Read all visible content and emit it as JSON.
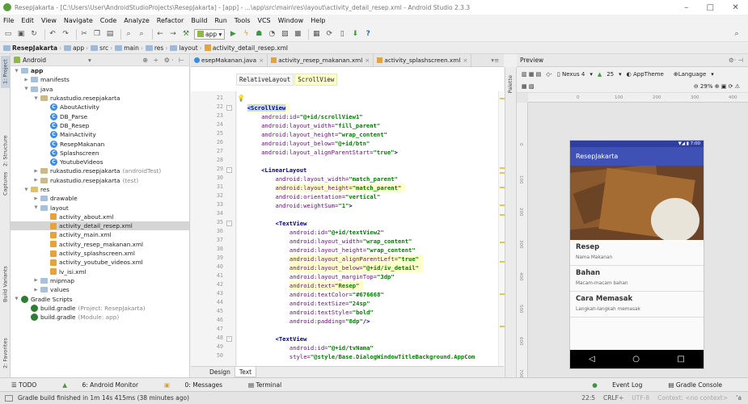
{
  "window": {
    "title": "ResepJakarta - [C:\\Users\\User\\AndroidStudioProjects\\ResepJakarta] - [app] - ...\\app\\src\\main\\res\\layout\\activity_detail_resep.xml - Android Studio 2.3.3"
  },
  "menu": [
    "File",
    "Edit",
    "View",
    "Navigate",
    "Code",
    "Analyze",
    "Refactor",
    "Build",
    "Run",
    "Tools",
    "VCS",
    "Window",
    "Help"
  ],
  "toolbar": {
    "app_selector": "app"
  },
  "breadcrumb": [
    "ResepJakarta",
    "app",
    "src",
    "main",
    "res",
    "layout",
    "activity_detail_resep.xml"
  ],
  "left_tool_tabs": [
    "1: Project",
    "2: Structure",
    "Captures",
    "Build Variants",
    "2: Favorites"
  ],
  "project_panel": {
    "view_mode": "Android",
    "tree": [
      {
        "label": "app",
        "indent": 0,
        "icon": "folder",
        "twisty": "open",
        "bold": true
      },
      {
        "label": "manifests",
        "indent": 1,
        "icon": "folder",
        "twisty": "closed"
      },
      {
        "label": "java",
        "indent": 1,
        "icon": "folder",
        "twisty": "open"
      },
      {
        "label": "rukastudio.resepjakarta",
        "indent": 2,
        "icon": "pkg",
        "twisty": "open"
      },
      {
        "label": "AboutActivity",
        "indent": 3,
        "icon": "cls"
      },
      {
        "label": "DB_Parse",
        "indent": 3,
        "icon": "cls"
      },
      {
        "label": "DB_Resep",
        "indent": 3,
        "icon": "cls"
      },
      {
        "label": "MainActivity",
        "indent": 3,
        "icon": "cls"
      },
      {
        "label": "ResepMakanan",
        "indent": 3,
        "icon": "cls"
      },
      {
        "label": "Splashscreen",
        "indent": 3,
        "icon": "cls"
      },
      {
        "label": "YoutubeVideos",
        "indent": 3,
        "icon": "cls"
      },
      {
        "label": "rukastudio.resepjakarta",
        "suffix": "(androidTest)",
        "indent": 2,
        "icon": "pkg",
        "twisty": "closed"
      },
      {
        "label": "rukastudio.resepjakarta",
        "suffix": "(test)",
        "indent": 2,
        "icon": "pkg",
        "twisty": "closed"
      },
      {
        "label": "res",
        "indent": 1,
        "icon": "res",
        "twisty": "open"
      },
      {
        "label": "drawable",
        "indent": 2,
        "icon": "folder",
        "twisty": "closed"
      },
      {
        "label": "layout",
        "indent": 2,
        "icon": "folder",
        "twisty": "open"
      },
      {
        "label": "activity_about.xml",
        "indent": 3,
        "icon": "xml"
      },
      {
        "label": "activity_detail_resep.xml",
        "indent": 3,
        "icon": "xml",
        "selected": true
      },
      {
        "label": "activity_main.xml",
        "indent": 3,
        "icon": "xml"
      },
      {
        "label": "activity_resep_makanan.xml",
        "indent": 3,
        "icon": "xml"
      },
      {
        "label": "activity_splashscreen.xml",
        "indent": 3,
        "icon": "xml"
      },
      {
        "label": "activity_youtube_videos.xml",
        "indent": 3,
        "icon": "xml"
      },
      {
        "label": "lv_isi.xml",
        "indent": 3,
        "icon": "xml"
      },
      {
        "label": "mipmap",
        "indent": 2,
        "icon": "folder",
        "twisty": "closed"
      },
      {
        "label": "values",
        "indent": 2,
        "icon": "folder",
        "twisty": "closed"
      },
      {
        "label": "Gradle Scripts",
        "indent": 0,
        "icon": "gscr",
        "twisty": "open"
      },
      {
        "label": "build.gradle",
        "suffix": "(Project: ResepJakarta)",
        "indent": 1,
        "icon": "gradle"
      },
      {
        "label": "build.gradle",
        "suffix": "(Module: app)",
        "indent": 1,
        "icon": "gradle"
      }
    ]
  },
  "editor_tabs": [
    {
      "label": "esepMakanan.java",
      "active": false,
      "java": true
    },
    {
      "label": "activity_resep_makanan.xml",
      "active": false
    },
    {
      "label": "activity_splashscreen.xml",
      "active": false
    }
  ],
  "editor_breadcrumb": [
    "RelativeLayout",
    "ScrollView"
  ],
  "code_lines": [
    {
      "n": "21",
      "parts": []
    },
    {
      "n": "22",
      "parts": [
        [
          "tag",
          "<ScrollView"
        ]
      ],
      "indent": 2,
      "highlight": true
    },
    {
      "n": "23",
      "parts": [
        [
          "attr",
          "android:id="
        ],
        [
          "val",
          "\"@+id/scrollView1\""
        ]
      ],
      "indent": 6
    },
    {
      "n": "24",
      "parts": [
        [
          "attr",
          "android:layout_width="
        ],
        [
          "val",
          "\"fill_parent\""
        ]
      ],
      "indent": 6
    },
    {
      "n": "25",
      "parts": [
        [
          "attr",
          "android:layout_height="
        ],
        [
          "val",
          "\"wrap_content\""
        ]
      ],
      "indent": 6
    },
    {
      "n": "26",
      "parts": [
        [
          "attr",
          "android:layout_below="
        ],
        [
          "val",
          "\"@+id/btn\""
        ]
      ],
      "indent": 6
    },
    {
      "n": "27",
      "parts": [
        [
          "attr",
          "android:layout_alignParentStart="
        ],
        [
          "val",
          "\"true\""
        ],
        [
          "tag",
          ">"
        ]
      ],
      "indent": 6
    },
    {
      "n": "28",
      "parts": []
    },
    {
      "n": "29",
      "parts": [
        [
          "tag",
          "<LinearLayout"
        ]
      ],
      "indent": 6
    },
    {
      "n": "30",
      "parts": [
        [
          "attr",
          "android:layout_width="
        ],
        [
          "val",
          "\"match_parent\""
        ]
      ],
      "indent": 10
    },
    {
      "n": "31",
      "parts": [
        [
          "attr",
          "android:layout_height="
        ],
        [
          "val",
          "\"match_parent\""
        ]
      ],
      "indent": 10,
      "highlight": true
    },
    {
      "n": "32",
      "parts": [
        [
          "attr",
          "android:orientation="
        ],
        [
          "val",
          "\"vertical\""
        ]
      ],
      "indent": 10
    },
    {
      "n": "33",
      "parts": [
        [
          "attr",
          "android:weightSum="
        ],
        [
          "val",
          "\"1\""
        ],
        [
          "tag",
          ">"
        ]
      ],
      "indent": 10
    },
    {
      "n": "34",
      "parts": []
    },
    {
      "n": "35",
      "parts": [
        [
          "tag",
          "<TextView"
        ]
      ],
      "indent": 10
    },
    {
      "n": "36",
      "parts": [
        [
          "attr",
          "android:id="
        ],
        [
          "val",
          "\"@+id/textView2\""
        ]
      ],
      "indent": 14
    },
    {
      "n": "37",
      "parts": [
        [
          "attr",
          "android:layout_width="
        ],
        [
          "val",
          "\"wrap_content\""
        ]
      ],
      "indent": 14
    },
    {
      "n": "38",
      "parts": [
        [
          "attr",
          "android:layout_height="
        ],
        [
          "val",
          "\"wrap_content\""
        ]
      ],
      "indent": 14
    },
    {
      "n": "39",
      "parts": [
        [
          "attr",
          "android:layout_alignParentLeft="
        ],
        [
          "val",
          "\"true\""
        ]
      ],
      "indent": 14,
      "highlight": true
    },
    {
      "n": "40",
      "parts": [
        [
          "attr",
          "android:layout_below="
        ],
        [
          "val",
          "\"@+id/iv_detail\""
        ]
      ],
      "indent": 14,
      "highlight": true
    },
    {
      "n": "41",
      "parts": [
        [
          "attr",
          "android:layout_marginTop="
        ],
        [
          "val",
          "\"3dp\""
        ]
      ],
      "indent": 14
    },
    {
      "n": "42",
      "parts": [
        [
          "attr",
          "android:text="
        ],
        [
          "val",
          "\"Resep\""
        ]
      ],
      "indent": 14,
      "highlight": true
    },
    {
      "n": "43",
      "parts": [
        [
          "attr",
          "android:textColor="
        ],
        [
          "val",
          "\"#676668\""
        ]
      ],
      "indent": 14
    },
    {
      "n": "44",
      "parts": [
        [
          "attr",
          "android:textSize="
        ],
        [
          "val",
          "\"24sp\""
        ]
      ],
      "indent": 14
    },
    {
      "n": "45",
      "parts": [
        [
          "attr",
          "android:textStyle="
        ],
        [
          "val",
          "\"bold\""
        ]
      ],
      "indent": 14
    },
    {
      "n": "46",
      "parts": [
        [
          "attr",
          "android:padding="
        ],
        [
          "val",
          "\"8dp\""
        ],
        [
          "tag",
          "/>"
        ]
      ],
      "indent": 14
    },
    {
      "n": "47",
      "parts": []
    },
    {
      "n": "48",
      "parts": [
        [
          "tag",
          "<TextView"
        ]
      ],
      "indent": 10
    },
    {
      "n": "49",
      "parts": [
        [
          "attr",
          "android:id="
        ],
        [
          "val",
          "\"@+id/tvNama\""
        ]
      ],
      "indent": 14
    },
    {
      "n": "50",
      "parts": [
        [
          "attr",
          "style="
        ],
        [
          "val",
          "\"@style/Base.DialogWindowTitleBackground.AppCom"
        ]
      ],
      "indent": 14
    }
  ],
  "design_tabs": [
    "Design",
    "Text"
  ],
  "palette_label": "Palette",
  "preview": {
    "title": "Preview",
    "device": "Nexus 4",
    "api": "25",
    "theme": "AppTheme",
    "language": "Language",
    "zoom": "29%",
    "ruler_h": [
      "0",
      "100",
      "200",
      "300",
      "400",
      "500"
    ],
    "ruler_v": [
      "0",
      "100",
      "200",
      "300",
      "400",
      "500",
      "600",
      "700"
    ],
    "status_time": "7:00",
    "app_title": "ResepJakarta",
    "cards": [
      {
        "title": "Resep",
        "sub": "Nama Makanan"
      },
      {
        "title": "Bahan",
        "sub": "Macam-macam bahan"
      },
      {
        "title": "Cara Memasak",
        "sub": "Langkah-langkah memasak"
      }
    ]
  },
  "bottom_tools": {
    "todo": "TODO",
    "monitor": "6: Android Monitor",
    "messages": "0: Messages",
    "terminal": "Terminal",
    "event_log": "Event Log",
    "gradle_console": "Gradle Console"
  },
  "status": {
    "message": "Gradle build finished in 1m 14s 415ms (38 minutes ago)",
    "position": "22:5",
    "line_sep": "CRLF÷",
    "encoding": "UTF-8",
    "context": "Context: <no context>"
  }
}
